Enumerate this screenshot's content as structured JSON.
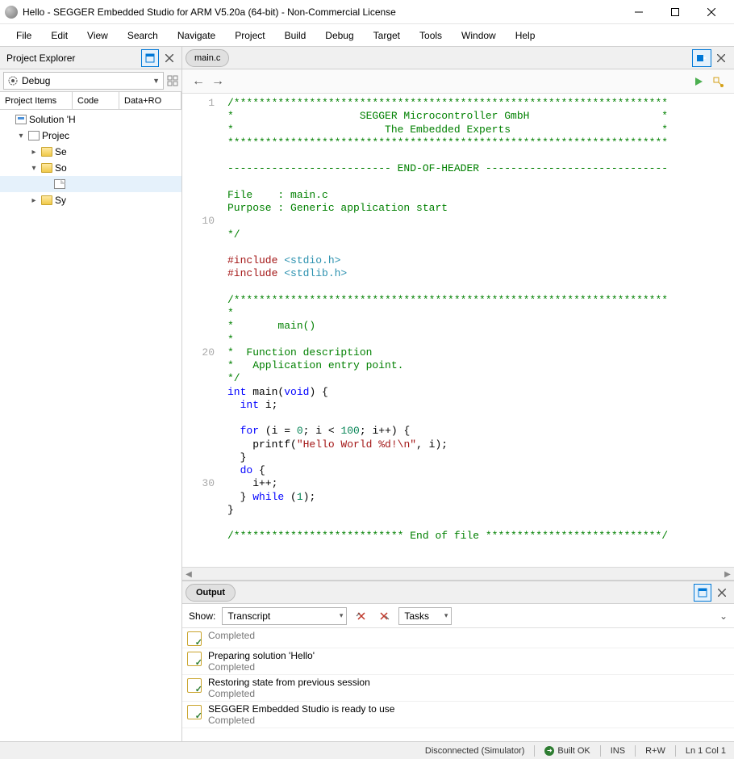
{
  "window": {
    "title": "Hello - SEGGER Embedded Studio for ARM V5.20a (64-bit) - Non-Commercial License"
  },
  "menu": [
    "File",
    "Edit",
    "View",
    "Search",
    "Navigate",
    "Project",
    "Build",
    "Debug",
    "Target",
    "Tools",
    "Window",
    "Help"
  ],
  "project_explorer": {
    "title": "Project Explorer",
    "config": "Debug",
    "columns": [
      "Project Items",
      "Code",
      "Data+RO"
    ],
    "tree": [
      {
        "level": 0,
        "exp": "",
        "icon": "solution",
        "label": "Solution 'H"
      },
      {
        "level": 1,
        "exp": "▾",
        "icon": "project",
        "label": "Projec"
      },
      {
        "level": 2,
        "exp": "▸",
        "icon": "folder",
        "label": "Se"
      },
      {
        "level": 2,
        "exp": "▾",
        "icon": "folder-open",
        "label": "So"
      },
      {
        "level": 3,
        "exp": "",
        "icon": "file",
        "label": "",
        "selected": true
      },
      {
        "level": 2,
        "exp": "▸",
        "icon": "folder",
        "label": "Sy"
      }
    ]
  },
  "editor": {
    "tab": "main.c",
    "line_markers": {
      "1": "1",
      "10": "10",
      "20": "20",
      "30": "30"
    },
    "code_lines": [
      {
        "t": "comment",
        "text": "/*********************************************************************"
      },
      {
        "t": "comment",
        "text": "*                    SEGGER Microcontroller GmbH                     *"
      },
      {
        "t": "comment",
        "text": "*                        The Embedded Experts                        *"
      },
      {
        "t": "comment",
        "text": "**********************************************************************"
      },
      {
        "t": "blank",
        "text": ""
      },
      {
        "t": "comment",
        "text": "-------------------------- END-OF-HEADER -----------------------------"
      },
      {
        "t": "blank",
        "text": ""
      },
      {
        "t": "comment",
        "text": "File    : main.c"
      },
      {
        "t": "comment",
        "text": "Purpose : Generic application start"
      },
      {
        "t": "blank",
        "text": ""
      },
      {
        "t": "comment",
        "text": "*/"
      },
      {
        "t": "blank",
        "text": ""
      },
      {
        "t": "include",
        "pre": "#include ",
        "ang": "<stdio.h>"
      },
      {
        "t": "include",
        "pre": "#include ",
        "ang": "<stdlib.h>"
      },
      {
        "t": "blank",
        "text": ""
      },
      {
        "t": "comment",
        "text": "/*********************************************************************"
      },
      {
        "t": "comment",
        "text": "*"
      },
      {
        "t": "comment",
        "text": "*       main()"
      },
      {
        "t": "comment",
        "text": "*"
      },
      {
        "t": "comment",
        "text": "*  Function description"
      },
      {
        "t": "comment",
        "text": "*   Application entry point."
      },
      {
        "t": "comment",
        "text": "*/"
      },
      {
        "t": "sig",
        "text": "int main(void) {"
      },
      {
        "t": "decl",
        "text": "  int i;"
      },
      {
        "t": "blank",
        "text": ""
      },
      {
        "t": "for",
        "text": "  for (i = 0; i < 100; i++) {"
      },
      {
        "t": "printf",
        "text": "    printf(\"Hello World %d!\\n\", i);"
      },
      {
        "t": "plain",
        "text": "  }"
      },
      {
        "t": "do",
        "text": "  do {"
      },
      {
        "t": "plain",
        "text": "    i++;"
      },
      {
        "t": "while",
        "text": "  } while (1);"
      },
      {
        "t": "plain",
        "text": "}"
      },
      {
        "t": "blank",
        "text": ""
      },
      {
        "t": "comment",
        "text": "/*************************** End of file ****************************/"
      }
    ]
  },
  "output": {
    "title": "Output",
    "show_label": "Show:",
    "filter1": "Transcript",
    "filter2": "Tasks",
    "entries": [
      {
        "title": "",
        "status": "Completed"
      },
      {
        "title": "Preparing solution 'Hello'",
        "status": "Completed"
      },
      {
        "title": "Restoring state from previous session",
        "status": "Completed"
      },
      {
        "title": "SEGGER Embedded Studio is ready to use",
        "status": "Completed"
      }
    ]
  },
  "statusbar": {
    "connection": "Disconnected (Simulator)",
    "build": "Built OK",
    "ins": "INS",
    "rw": "R+W",
    "pos": "Ln 1 Col 1"
  }
}
